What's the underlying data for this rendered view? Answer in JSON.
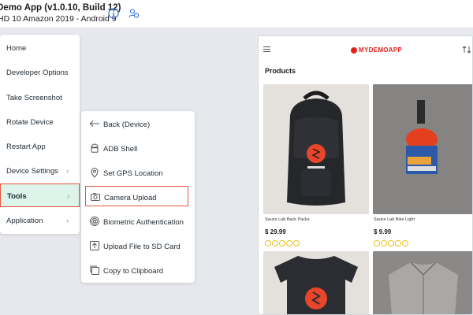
{
  "header": {
    "app_title": "Demo App (v1.0.10, Build 12)",
    "device_subtitle": "HD 10 Amazon 2019 - Android 9",
    "info_icon": "info-icon",
    "people_icon": "people-icon"
  },
  "main_menu": {
    "items": [
      {
        "label": "Home"
      },
      {
        "label": "Developer Options"
      },
      {
        "label": "Take Screenshot"
      },
      {
        "label": "Rotate Device"
      },
      {
        "label": "Restart App"
      },
      {
        "label": "Device Settings",
        "has_submenu": true
      },
      {
        "label": "Tools",
        "has_submenu": true,
        "active": true
      },
      {
        "label": "Application",
        "has_submenu": true
      }
    ]
  },
  "tools_submenu": {
    "items": [
      {
        "label": "Back (Device)",
        "icon": "back-arrow-icon"
      },
      {
        "label": "ADB Shell",
        "icon": "android-icon"
      },
      {
        "label": "Set GPS Location",
        "icon": "location-pin-icon"
      },
      {
        "label": "Camera Upload",
        "icon": "camera-icon",
        "highlighted": true
      },
      {
        "label": "Biometric Authentication",
        "icon": "fingerprint-icon"
      },
      {
        "label": "Upload File to SD Card",
        "icon": "upload-icon"
      },
      {
        "label": "Copy to Clipboard",
        "icon": "clipboard-icon"
      }
    ]
  },
  "device_screen": {
    "logo": "MYDEMOAPP",
    "section_title": "Products",
    "products": [
      {
        "name": "Sauce Lab Back Packs",
        "price": "$ 29.99",
        "image": "black-backpack"
      },
      {
        "name": "Sauce Lab Bike Light",
        "price": "$ 9.99",
        "image": "bike-light"
      },
      {
        "name": "",
        "price": "",
        "image": "black-tshirt"
      },
      {
        "name": "",
        "price": "",
        "image": "grey-jacket"
      }
    ]
  },
  "colors": {
    "accent_red": "#e0563a",
    "active_bg": "#dcf4ea",
    "brand_red": "#e2231a",
    "star_yellow": "#e8c01f"
  }
}
